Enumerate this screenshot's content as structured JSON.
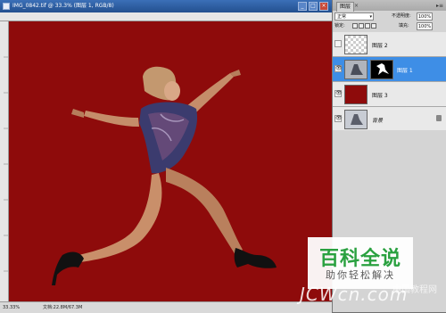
{
  "document": {
    "title": "IMG_0842.tif @ 33.3% (图层 1, RGB/8)",
    "status_zoom": "33.33%",
    "status_docsize": "文档:22.8M/67.3M"
  },
  "window_buttons": {
    "minimize": "_",
    "maximize": "□",
    "close": "×"
  },
  "layers_panel": {
    "tab_label": "图层",
    "tab_close": "×",
    "menu_label": "▸≡",
    "blend_mode": "正常",
    "opacity_label": "不透明度:",
    "opacity_value": "100%",
    "lock_label": "锁定:",
    "fill_label": "填充:",
    "fill_value": "100%",
    "layers": [
      {
        "name": "图层 2",
        "visible": false,
        "selected": false
      },
      {
        "name": "图层 1",
        "visible": true,
        "selected": true
      },
      {
        "name": "图层 3",
        "visible": true,
        "selected": false
      },
      {
        "name": "背景",
        "visible": true,
        "selected": false
      }
    ]
  },
  "colors": {
    "canvas_red": "#8e0b0b",
    "layer3_fill": "#8e0b0b",
    "selected_row": "#3e8ee6",
    "titlebar": "#23508f",
    "watermark_green": "#2aa140"
  },
  "watermark": {
    "logo_text": "百科全说",
    "slogan": "助你轻松解决",
    "site": "JCWcn.com",
    "site_sub": "中国教程网"
  }
}
